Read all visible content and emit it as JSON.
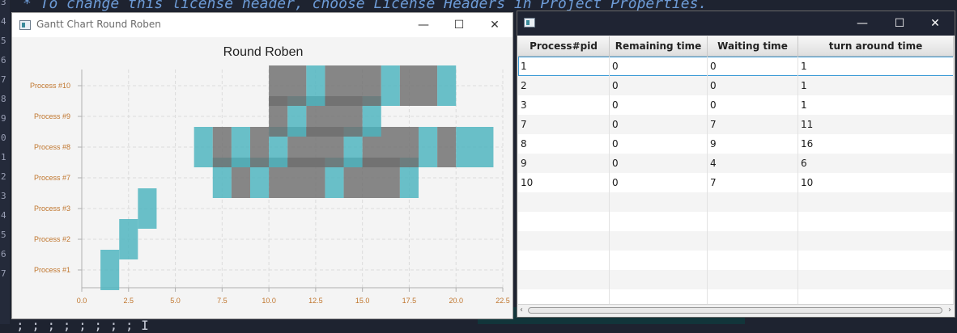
{
  "ide": {
    "code_line": "* To change this license header, choose License Headers in Project Properties.",
    "bottom_line": "; ; ; ; ; ; ; ; I",
    "gutter": [
      "3",
      "4",
      "5",
      "6",
      "7",
      "8",
      "9",
      "0",
      "1",
      "2",
      "3",
      "4",
      "5",
      "6",
      "7"
    ]
  },
  "gantt_window": {
    "title": "Gantt Chart Round Roben",
    "chart_data": {
      "type": "gantt",
      "title": "Round Roben",
      "xlim": [
        0,
        22.5
      ],
      "xticks": [
        "0.0",
        "2.5",
        "5.0",
        "7.5",
        "10.0",
        "12.5",
        "15.0",
        "17.5",
        "20.0",
        "22.5"
      ],
      "categories": [
        "Process #1",
        "Process #2",
        "Process #3",
        "Process #7",
        "Process #8",
        "Process #9",
        "Process #10"
      ],
      "colors": {
        "teal": "#4ab3be",
        "gray": "#6e6e6e"
      },
      "segments": [
        {
          "process": "Process #1",
          "start": 1,
          "end": 2,
          "color": "teal"
        },
        {
          "process": "Process #2",
          "start": 2,
          "end": 3,
          "color": "teal"
        },
        {
          "process": "Process #3",
          "start": 3,
          "end": 4,
          "color": "teal"
        },
        {
          "process": "Process #7",
          "start": 7,
          "end": 8,
          "color": "teal"
        },
        {
          "process": "Process #7",
          "start": 8,
          "end": 9,
          "color": "gray"
        },
        {
          "process": "Process #7",
          "start": 9,
          "end": 10,
          "color": "teal"
        },
        {
          "process": "Process #7",
          "start": 10,
          "end": 13,
          "color": "gray"
        },
        {
          "process": "Process #7",
          "start": 13,
          "end": 14,
          "color": "teal"
        },
        {
          "process": "Process #7",
          "start": 14,
          "end": 17,
          "color": "gray"
        },
        {
          "process": "Process #7",
          "start": 17,
          "end": 18,
          "color": "teal"
        },
        {
          "process": "Process #8",
          "start": 6,
          "end": 7,
          "color": "teal"
        },
        {
          "process": "Process #8",
          "start": 7,
          "end": 8,
          "color": "gray"
        },
        {
          "process": "Process #8",
          "start": 8,
          "end": 9,
          "color": "teal"
        },
        {
          "process": "Process #8",
          "start": 9,
          "end": 10,
          "color": "gray"
        },
        {
          "process": "Process #8",
          "start": 10,
          "end": 11,
          "color": "teal"
        },
        {
          "process": "Process #8",
          "start": 11,
          "end": 14,
          "color": "gray"
        },
        {
          "process": "Process #8",
          "start": 14,
          "end": 15,
          "color": "teal"
        },
        {
          "process": "Process #8",
          "start": 15,
          "end": 18,
          "color": "gray"
        },
        {
          "process": "Process #8",
          "start": 18,
          "end": 19,
          "color": "teal"
        },
        {
          "process": "Process #8",
          "start": 19,
          "end": 20,
          "color": "gray"
        },
        {
          "process": "Process #8",
          "start": 20,
          "end": 22,
          "color": "teal"
        },
        {
          "process": "Process #9",
          "start": 10,
          "end": 11,
          "color": "gray"
        },
        {
          "process": "Process #9",
          "start": 11,
          "end": 12,
          "color": "teal"
        },
        {
          "process": "Process #9",
          "start": 12,
          "end": 15,
          "color": "gray"
        },
        {
          "process": "Process #9",
          "start": 15,
          "end": 16,
          "color": "teal"
        },
        {
          "process": "Process #10",
          "start": 10,
          "end": 12,
          "color": "gray"
        },
        {
          "process": "Process #10",
          "start": 12,
          "end": 13,
          "color": "teal"
        },
        {
          "process": "Process #10",
          "start": 13,
          "end": 16,
          "color": "gray"
        },
        {
          "process": "Process #10",
          "start": 16,
          "end": 17,
          "color": "teal"
        },
        {
          "process": "Process #10",
          "start": 17,
          "end": 19,
          "color": "gray"
        },
        {
          "process": "Process #10",
          "start": 19,
          "end": 20,
          "color": "teal"
        }
      ]
    }
  },
  "table_window": {
    "columns": [
      "Process#pid",
      "Remaining time",
      "Waiting time",
      "turn around time"
    ],
    "rows": [
      [
        "1",
        "0",
        "0",
        "1"
      ],
      [
        "2",
        "0",
        "0",
        "1"
      ],
      [
        "3",
        "0",
        "0",
        "1"
      ],
      [
        "7",
        "0",
        "7",
        "11"
      ],
      [
        "8",
        "0",
        "9",
        "16"
      ],
      [
        "9",
        "0",
        "4",
        "6"
      ],
      [
        "10",
        "0",
        "7",
        "10"
      ],
      [
        "",
        "",
        "",
        ""
      ],
      [
        "",
        "",
        "",
        ""
      ],
      [
        "",
        "",
        "",
        ""
      ],
      [
        "",
        "",
        "",
        ""
      ],
      [
        "",
        "",
        "",
        ""
      ],
      [
        "",
        "",
        "",
        ""
      ]
    ]
  }
}
